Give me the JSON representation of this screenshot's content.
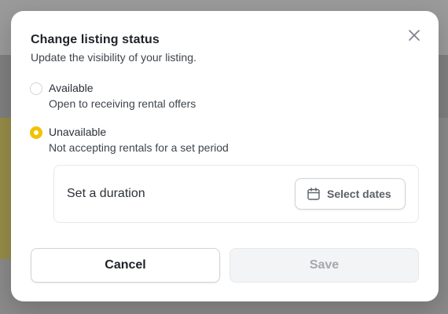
{
  "modal": {
    "title": "Change listing status",
    "subtitle": "Update the visibility of your listing."
  },
  "options": [
    {
      "label": "Available",
      "description": "Open to receiving rental offers",
      "selected": false
    },
    {
      "label": "Unavailable",
      "description": "Not accepting rentals for a set period",
      "selected": true
    }
  ],
  "duration": {
    "label": "Set a duration",
    "button_label": "Select dates",
    "button_icon": "calendar-icon"
  },
  "actions": {
    "cancel_label": "Cancel",
    "save_label": "Save",
    "save_disabled": true
  },
  "icons": {
    "close": "close-icon"
  },
  "colors": {
    "accent": "#f2c200",
    "text_primary": "#1f2328",
    "text_secondary": "#3f454c",
    "border": "#cfd3d8",
    "disabled_bg": "#f3f4f5",
    "disabled_text": "#a3a8ae"
  }
}
